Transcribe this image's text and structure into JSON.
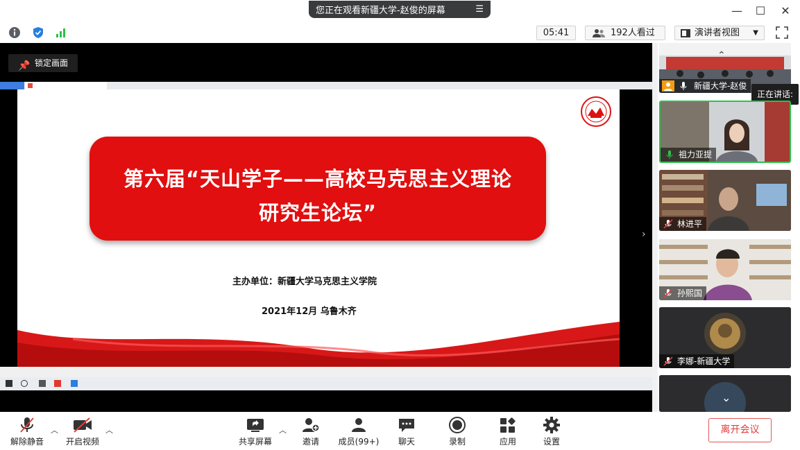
{
  "titlebar": {
    "share_banner": "您正在观看新疆大学-赵俊的屏幕",
    "minimize": "—",
    "maximize": "☐",
    "close": "✕"
  },
  "status": {
    "time": "05:41",
    "viewers": "192人看过",
    "view_mode": "演讲者视图"
  },
  "share": {
    "lock_label": "锁定画面",
    "slide_title_line1": "第六届“天山学子——高校马克思主义理论",
    "slide_title_line2": "研究生论坛”",
    "host": "主办单位：新疆大学马克思主义学院",
    "date": "2021年12月   乌鲁木齐"
  },
  "gallery": {
    "speaking_tip": "正在讲话:",
    "participants": [
      {
        "name": "新疆大学-赵俊"
      },
      {
        "name": "祖力亚提"
      },
      {
        "name": "林进平"
      },
      {
        "name": "孙熙国"
      },
      {
        "name": "李娜-新疆大学"
      }
    ]
  },
  "controls": {
    "unmute": "解除静音",
    "start_video": "开启视频",
    "share_screen": "共享屏幕",
    "invite": "邀请",
    "members": "成员(99+)",
    "chat": "聊天",
    "record": "录制",
    "apps": "应用",
    "settings": "设置",
    "leave": "离开会议"
  },
  "colors": {
    "accent_red": "#e10f0f",
    "leave_red": "#e33c3c",
    "active_green": "#2fbf4a"
  }
}
